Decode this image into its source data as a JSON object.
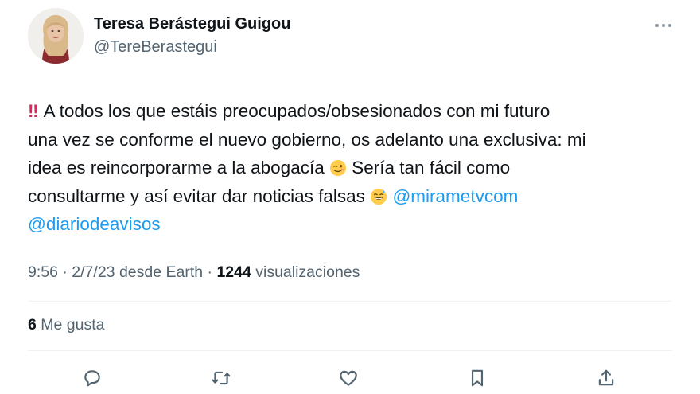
{
  "user": {
    "display_name": "Teresa Berástegui Guigou",
    "handle": "@TereBerastegui",
    "avatar_icon": "profile-photo"
  },
  "tweet": {
    "line1": "A todos los que estáis preocupados/obsesionados con mi futuro",
    "line2": "una vez se conforme el nuevo gobierno, os adelanto una exclusiva: mi",
    "line3_a": "idea es reincorporarme a la abogacía",
    "line3_b": "Sería tan fácil como",
    "line4_a": "consultarme y así evitar dar noticias falsas",
    "mention1": "@mirametvcom",
    "mention2": "@diariodeavisos",
    "bangs": "‼"
  },
  "meta": {
    "time": "9:56",
    "date": "2/7/23",
    "source": "desde Earth",
    "views_count": "1244",
    "views_label": "visualizaciones"
  },
  "likes": {
    "count": "6",
    "label": "Me gusta"
  },
  "colors": {
    "text": "#0f1419",
    "secondary": "#536471",
    "link": "#1d9bf0",
    "divider": "#eff3f4"
  },
  "icons": [
    "more-icon",
    "reply-icon",
    "retweet-icon",
    "like-icon",
    "bookmark-icon",
    "share-icon",
    "wink-emoji",
    "sweat-smile-emoji",
    "double-exclamation-emoji"
  ]
}
